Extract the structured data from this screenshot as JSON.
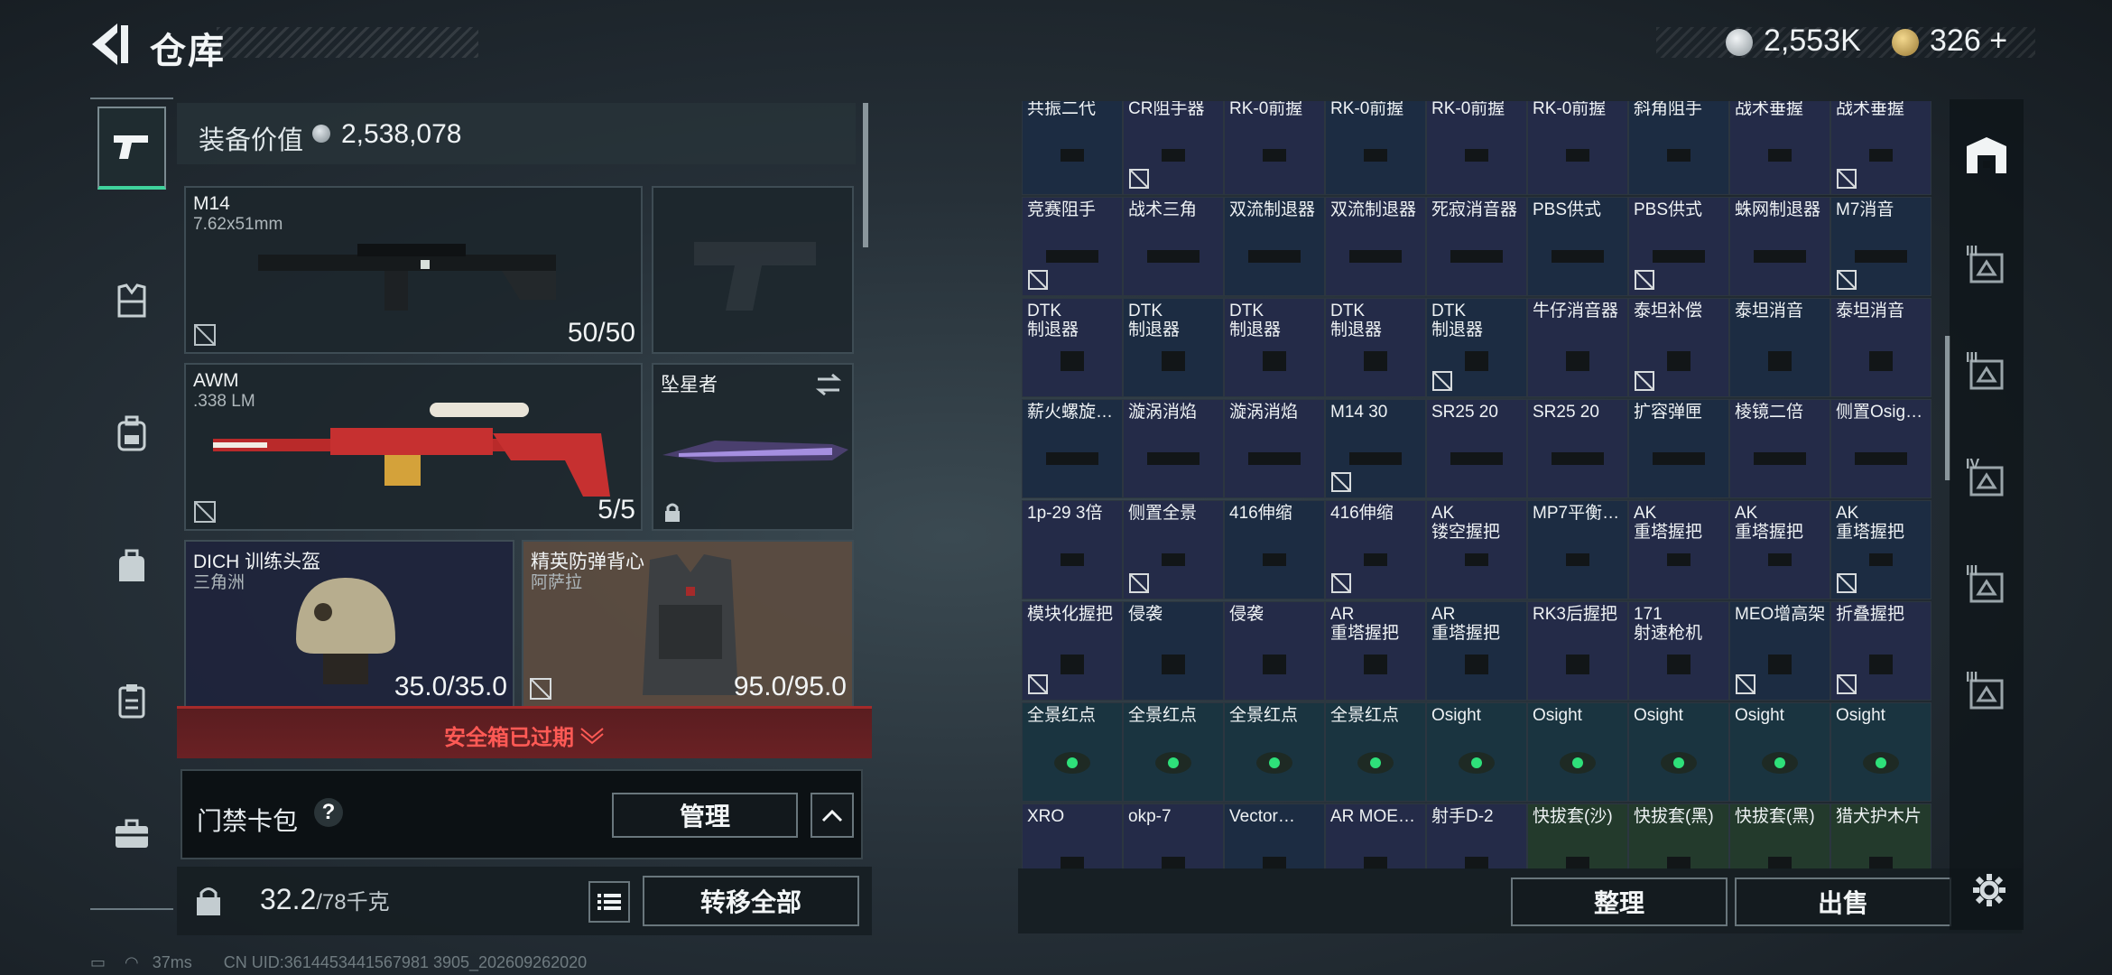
{
  "header": {
    "title": "仓库"
  },
  "currency": [
    {
      "icon": "silver-coin-icon",
      "value": "2,553K",
      "color": "#c9d1d5"
    },
    {
      "icon": "gold-coin-icon",
      "value": "326",
      "plus": "+",
      "color": "#c8a25a"
    }
  ],
  "left_nav": [
    {
      "icon": "pistol-icon",
      "active": true
    },
    {
      "icon": "armor-vest-icon"
    },
    {
      "icon": "backpack-icon"
    },
    {
      "icon": "bag-icon"
    },
    {
      "icon": "clipboard-icon"
    },
    {
      "icon": "toolbox-icon"
    }
  ],
  "loadout": {
    "value_label": "装备价值",
    "value": "2,538,078",
    "primary": {
      "name": "M14",
      "ammo": "7.62x51mm",
      "count": "50/50"
    },
    "secondary": {
      "name": "AWM",
      "ammo": ".338 LM",
      "count": "5/5"
    },
    "melee": {
      "name": "坠星者"
    },
    "helmet": {
      "name": "DICH 训练头盔",
      "sub": "三角洲",
      "durability": "35.0/35.0"
    },
    "vest": {
      "name": "精英防弹背心",
      "sub": "阿萨拉",
      "durability": "95.0/95.0"
    },
    "safe_box_status": "安全箱已过期",
    "card_pack": {
      "label": "门禁卡包",
      "help": "?",
      "manage": "管理"
    },
    "weight": {
      "current": "32.2",
      "max": "/78千克"
    },
    "transfer_all": "转移全部"
  },
  "inventory": {
    "rows": [
      [
        "共振二代",
        "CR阻手器",
        "RK-0前握",
        "RK-0前握",
        "RK-0前握",
        "RK-0前握",
        "斜角阻手",
        "战术垂握",
        "战术垂握"
      ],
      [
        "竞赛阻手",
        "战术三角",
        "双流制退器",
        "双流制退器",
        "死寂消音器",
        "PBS供式",
        "PBS供式",
        "蛛网制退器",
        "M7消音"
      ],
      [
        "DTK\n制退器",
        "DTK\n制退器",
        "DTK\n制退器",
        "DTK\n制退器",
        "DTK\n制退器",
        "牛仔消音器",
        "泰坦补偿",
        "泰坦消音",
        "泰坦消音"
      ],
      [
        "薪火螺旋…",
        "漩涡消焰",
        "漩涡消焰",
        "M14 30",
        "SR25 20",
        "SR25 20",
        "扩容弹匣",
        "棱镜二倍",
        "侧置Osig…"
      ],
      [
        "1p-29 3倍",
        "侧置全景",
        "416伸缩",
        "416伸缩",
        "AK\n镂空握把",
        "MP7平衡…",
        "AK\n重塔握把",
        "AK\n重塔握把",
        "AK\n重塔握把"
      ],
      [
        "模块化握把",
        "侵袭",
        "侵袭",
        "AR\n重塔握把",
        "AR\n重塔握把",
        "RK3后握把",
        "171\n射速枪机",
        "MEO增高架",
        "折叠握把"
      ],
      [
        "全景红点",
        "全景红点",
        "全景红点",
        "全景红点",
        "Osight",
        "Osight",
        "Osight",
        "Osight",
        "Osight"
      ],
      [
        "XRO",
        "okp-7",
        "Vector…",
        "AR MOE…",
        "射手D-2",
        "快拔套(沙)",
        "快拔套(黑)",
        "快拔套(黑)",
        "猎犬护木片"
      ]
    ]
  },
  "inventory_actions": {
    "sort": "整理",
    "sell": "出售"
  },
  "right_nav": [
    {
      "icon": "storage-icon",
      "roman": ""
    },
    {
      "icon": "depot-tab-icon",
      "roman": "III"
    },
    {
      "icon": "depot-tab-icon",
      "roman": "III"
    },
    {
      "icon": "depot-tab-icon",
      "roman": "IV"
    },
    {
      "icon": "depot-tab-icon",
      "roman": "III"
    },
    {
      "icon": "depot-tab-icon",
      "roman": "III"
    },
    {
      "icon": "depot-tab-icon",
      "roman": "IV"
    }
  ],
  "status": {
    "ping": "37ms",
    "uid": "CN UID:3614453441567981 3905_202609262020"
  }
}
